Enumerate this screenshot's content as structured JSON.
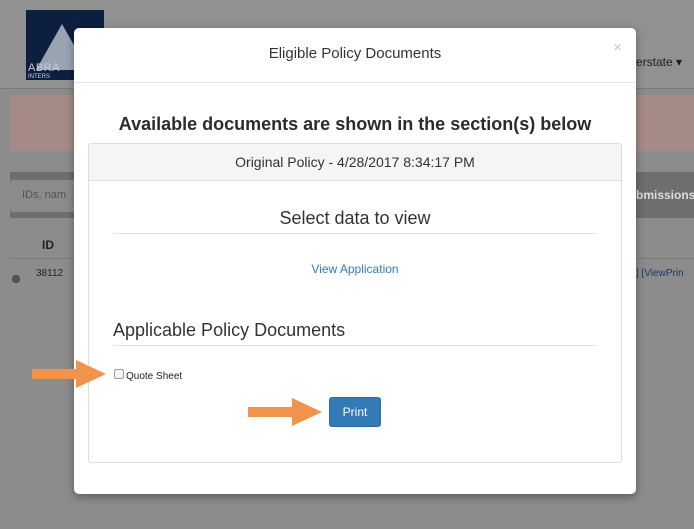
{
  "background": {
    "logo_text": "ABRA",
    "logo_subtext": "INTERS",
    "user_menu": "erstate",
    "user_menu_icon": "caret-down-icon",
    "search_placeholder": "IDs, nam",
    "submissions_label": "bmissions",
    "table_header_id": "ID",
    "row_id": "38112",
    "row_link": "] [ViewPrin"
  },
  "modal": {
    "title": "Eligible Policy Documents",
    "close_glyph": "×",
    "heading": "Available documents are shown in the section(s) below",
    "panel": {
      "heading": "Original Policy - 4/28/2017 8:34:17 PM",
      "select_title": "Select data to view",
      "view_link": "View Application",
      "docs_title": "Applicable Policy Documents",
      "checkbox_label": "Quote Sheet",
      "checkbox_checked": false,
      "print_label": "Print"
    }
  },
  "colors": {
    "primary": "#337ab7",
    "arrow": "#f0944d"
  }
}
